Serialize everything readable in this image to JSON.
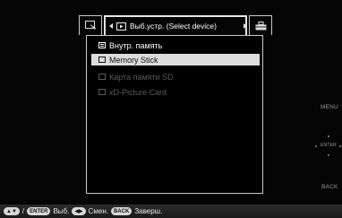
{
  "tabs": {
    "current_label": "Выб.устр. (Select device)"
  },
  "device_list": {
    "header": "Внутр. память",
    "items": [
      {
        "label": "Memory Stick",
        "state": "selected"
      },
      {
        "label": "Карта памяти SD",
        "state": "disabled"
      },
      {
        "label": "xD-Picture Card",
        "state": "disabled"
      }
    ]
  },
  "side_buttons": {
    "menu": "MENU",
    "enter": "ENTER",
    "back": "BACK"
  },
  "bottom_bar": {
    "slash": "/",
    "enter_key": "ENTER",
    "enter_action": "Выб.",
    "change_action": "Смен.",
    "back_key": "BACK",
    "back_action": "Заверш."
  },
  "colors": {
    "selected_bg": "#dcdcdc",
    "disabled_text": "#5a5a5a",
    "border": "#c8c8c8"
  }
}
